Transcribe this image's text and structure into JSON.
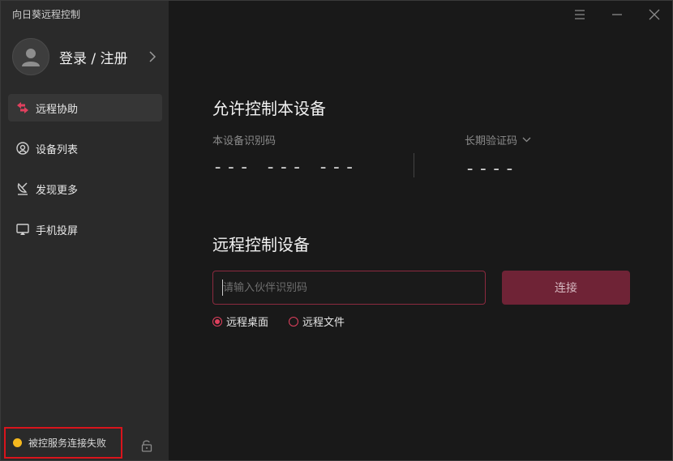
{
  "app": {
    "title": "向日葵远程控制"
  },
  "user": {
    "login_label": "登录 / 注册"
  },
  "sidebar": {
    "items": [
      {
        "label": "远程协助",
        "icon": "remote-assist-icon",
        "active": true
      },
      {
        "label": "设备列表",
        "icon": "device-list-icon",
        "active": false
      },
      {
        "label": "发现更多",
        "icon": "discover-icon",
        "active": false
      },
      {
        "label": "手机投屏",
        "icon": "screen-cast-icon",
        "active": false
      }
    ],
    "status_text": "被控服务连接失败"
  },
  "allow_section": {
    "title": "允许控制本设备",
    "device_id_label": "本设备识别码",
    "device_id_value": "--- --- ---",
    "verify_label": "长期验证码",
    "verify_value": "----"
  },
  "control_section": {
    "title": "远程控制设备",
    "input_placeholder": "请输入伙伴识别码",
    "connect_label": "连接",
    "options": [
      {
        "label": "远程桌面",
        "selected": true
      },
      {
        "label": "远程文件",
        "selected": false
      }
    ]
  },
  "colors": {
    "accent": "#e0405e",
    "connect_bg": "#6f2336",
    "status_dot": "#f5b81e",
    "highlight_border": "#d9141c"
  }
}
